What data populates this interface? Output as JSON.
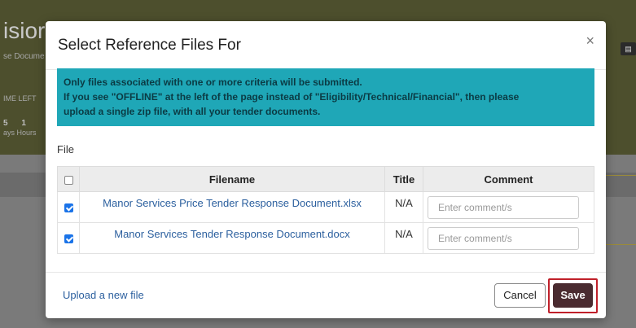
{
  "background": {
    "title_fragment": "isior",
    "subtitle_fragment": "se Docume",
    "time_left": "IME LEFT",
    "time_numbers": "5 1",
    "time_units": "ays Hours"
  },
  "modal": {
    "title": "Select Reference Files For",
    "close": "×",
    "alert_lines": [
      "Only files associated with one or more criteria will be submitted.",
      "If you see \"OFFLINE\" at the left of the page instead of \"Eligibility/Technical/Financial\", then please",
      "upload a single zip file, with all your tender documents."
    ],
    "file_label": "File",
    "columns": {
      "filename": "Filename",
      "title": "Title",
      "comment": "Comment"
    },
    "rows": [
      {
        "filename": "Manor Services Price Tender Response Document.xlsx",
        "title": "N/A",
        "comment_placeholder": "Enter comment/s",
        "checked": true
      },
      {
        "filename": "Manor Services Tender Response Document.docx",
        "title": "N/A",
        "comment_placeholder": "Enter comment/s",
        "checked": true
      }
    ],
    "upload_link": "Upload a new file",
    "cancel_label": "Cancel",
    "save_label": "Save"
  },
  "colors": {
    "alert_bg": "#1fa7b7",
    "save_bg": "#4a2b30",
    "highlight": "#c0202a",
    "link": "#2b5f9e"
  }
}
